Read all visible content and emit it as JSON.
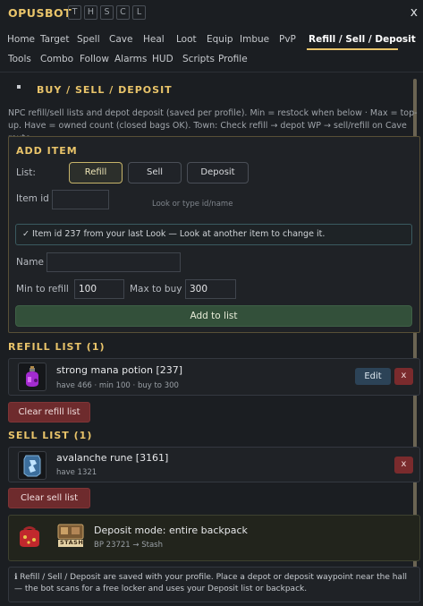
{
  "app": {
    "title": "OPUSBOT",
    "mini_buttons": [
      "T",
      "H",
      "S",
      "C",
      "L"
    ],
    "close": "x"
  },
  "tabs_row1": [
    "Home",
    "Target",
    "Spell",
    "Cave",
    "Heal",
    "Loot",
    "Equip",
    "Imbue",
    "PvP",
    "Refill / Sell / Deposit"
  ],
  "tabs_row2": [
    "Tools",
    "Combo",
    "Follow",
    "Alarms",
    "HUD",
    "Scripts",
    "Profile"
  ],
  "active_tab": "Refill / Sell / Deposit",
  "page": {
    "heading": "BUY / SELL / DEPOSIT",
    "description": "NPC refill/sell lists and depot deposit (saved per profile). Min = restock when below · Max = top-up. Have = owned count (closed bags OK). Town: Check refill → depot WP → sell/refill on Cave route."
  },
  "add_item": {
    "heading": "ADD ITEM",
    "list_label": "List:",
    "list_options": [
      "Refill",
      "Sell",
      "Deposit"
    ],
    "selected_list": "Refill",
    "item_id_label": "Item id",
    "item_id_value": "",
    "item_id_hint": "Look or type id/name",
    "info_icon": "check-icon",
    "info_text": "✓ Item id 237 from your last Look — Look at another item to change it.",
    "name_label": "Name",
    "name_value": "",
    "min_label": "Min to refill",
    "min_value": "100",
    "max_label": "Max to buy",
    "max_value": "300",
    "add_button": "Add to list"
  },
  "refill_list": {
    "heading": "REFILL LIST (1)",
    "items": [
      {
        "icon": "mana-potion-icon",
        "name": "strong mana potion  [237]",
        "sub": "have 466  ·  min 100  ·  buy to 300",
        "edit": "Edit",
        "remove": "x"
      }
    ],
    "clear_button": "Clear refill list"
  },
  "sell_list": {
    "heading": "SELL LIST (1)",
    "items": [
      {
        "icon": "rune-icon",
        "name": "avalanche rune  [3161]",
        "sub": "have 1321",
        "remove": "x"
      }
    ],
    "clear_button": "Clear sell list"
  },
  "deposit": {
    "title": "Deposit mode: entire backpack",
    "sub": "BP 23721 → Stash",
    "stash_label": "STASH"
  },
  "footer_note": "ℹ Refill / Sell / Deposit are saved with your profile. Place a depot or deposit waypoint near the hall — the bot scans for a free locker and uses your Deposit list or backpack.",
  "colors": {
    "accent": "#e9c46a",
    "danger": "#7a2b2d",
    "success": "#33503a",
    "info": "#2c4357"
  }
}
